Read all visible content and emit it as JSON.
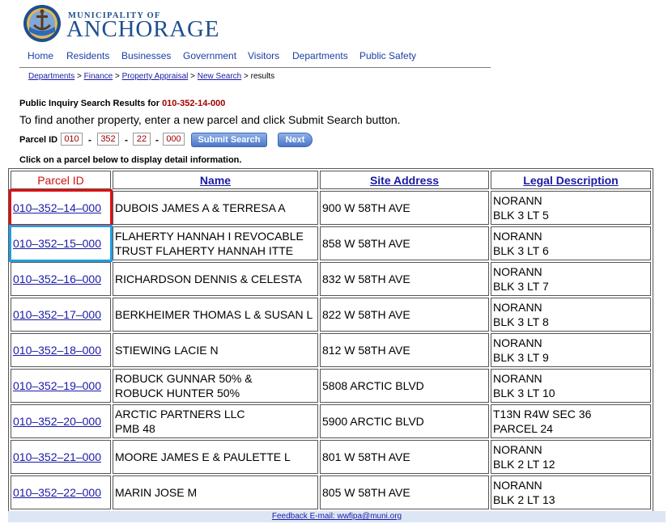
{
  "logo": {
    "small": "MUNICIPALITY OF",
    "big": "ANCHORAGE"
  },
  "nav": [
    "Home",
    "Residents",
    "Businesses",
    "Government",
    "Visitors",
    "Departments",
    "Public Safety"
  ],
  "breadcrumb": {
    "items": [
      "Departments",
      "Finance",
      "Property Appraisal",
      "New Search"
    ],
    "separator": ">",
    "current": "results"
  },
  "results_title": {
    "label": "Public Inquiry Search Results for",
    "parcel": "010-352-14-000"
  },
  "instructions": "To find another property, enter a new parcel and click Submit Search button.",
  "parcel_form": {
    "label": "Parcel ID",
    "part1": "010",
    "part2": "352",
    "part3": "22",
    "part4": "000",
    "submit_label": "Submit Search",
    "next_label": "Next"
  },
  "click_note": "Click on a parcel below to display detail information.",
  "table": {
    "headers": [
      "Parcel ID",
      "Name",
      "Site Address",
      "Legal Description"
    ],
    "rows": [
      {
        "parcel": "010–352–14–000",
        "name": [
          "DUBOIS JAMES A & TERRESA A"
        ],
        "address": "900 W 58TH AVE",
        "legal": [
          "NORANN",
          "BLK 3 LT 5"
        ]
      },
      {
        "parcel": "010–352–15–000",
        "name": [
          "FLAHERTY HANNAH I REVOCABLE",
          "TRUST FLAHERTY HANNAH ITTE"
        ],
        "address": "858 W 58TH AVE",
        "legal": [
          "NORANN",
          "BLK 3 LT 6"
        ]
      },
      {
        "parcel": "010–352–16–000",
        "name": [
          "RICHARDSON DENNIS & CELESTA"
        ],
        "address": "832 W 58TH AVE",
        "legal": [
          "NORANN",
          "BLK 3 LT 7"
        ]
      },
      {
        "parcel": "010–352–17–000",
        "name": [
          "BERKHEIMER THOMAS L & SUSAN L"
        ],
        "address": "822 W 58TH AVE",
        "legal": [
          "NORANN",
          "BLK 3 LT 8"
        ]
      },
      {
        "parcel": "010–352–18–000",
        "name": [
          "STIEWING LACIE N"
        ],
        "address": "812 W 58TH AVE",
        "legal": [
          "NORANN",
          "BLK 3 LT 9"
        ]
      },
      {
        "parcel": "010–352–19–000",
        "name": [
          "ROBUCK GUNNAR 50% &",
          "ROBUCK HUNTER 50%"
        ],
        "address": "5808 ARCTIC BLVD",
        "legal": [
          "NORANN",
          "BLK 3 LT 10"
        ]
      },
      {
        "parcel": "010–352–20–000",
        "name": [
          "ARCTIC PARTNERS LLC",
          "PMB 48"
        ],
        "address": "5900 ARCTIC BLVD",
        "legal": [
          "T13N R4W SEC 36",
          "PARCEL 24"
        ]
      },
      {
        "parcel": "010–352–21–000",
        "name": [
          "MOORE JAMES E & PAULETTE L"
        ],
        "address": "801 W 58TH AVE",
        "legal": [
          "NORANN",
          "BLK 2 LT 12"
        ]
      },
      {
        "parcel": "010–352–22–000",
        "name": [
          "MARIN JOSE M"
        ],
        "address": "805 W 58TH AVE",
        "legal": [
          "NORANN",
          "BLK 2 LT 13"
        ]
      }
    ]
  },
  "footer": "Feedback E-mail: wwfipa@muni.org",
  "colors": {
    "link": "#1a1aa6",
    "brand": "#1f4f8f",
    "parcel_red": "#a00000",
    "highlight_red": "#e01010",
    "highlight_blue": "#1fa0e0"
  },
  "highlighted_rows": {
    "red": 0,
    "blue": 1
  }
}
